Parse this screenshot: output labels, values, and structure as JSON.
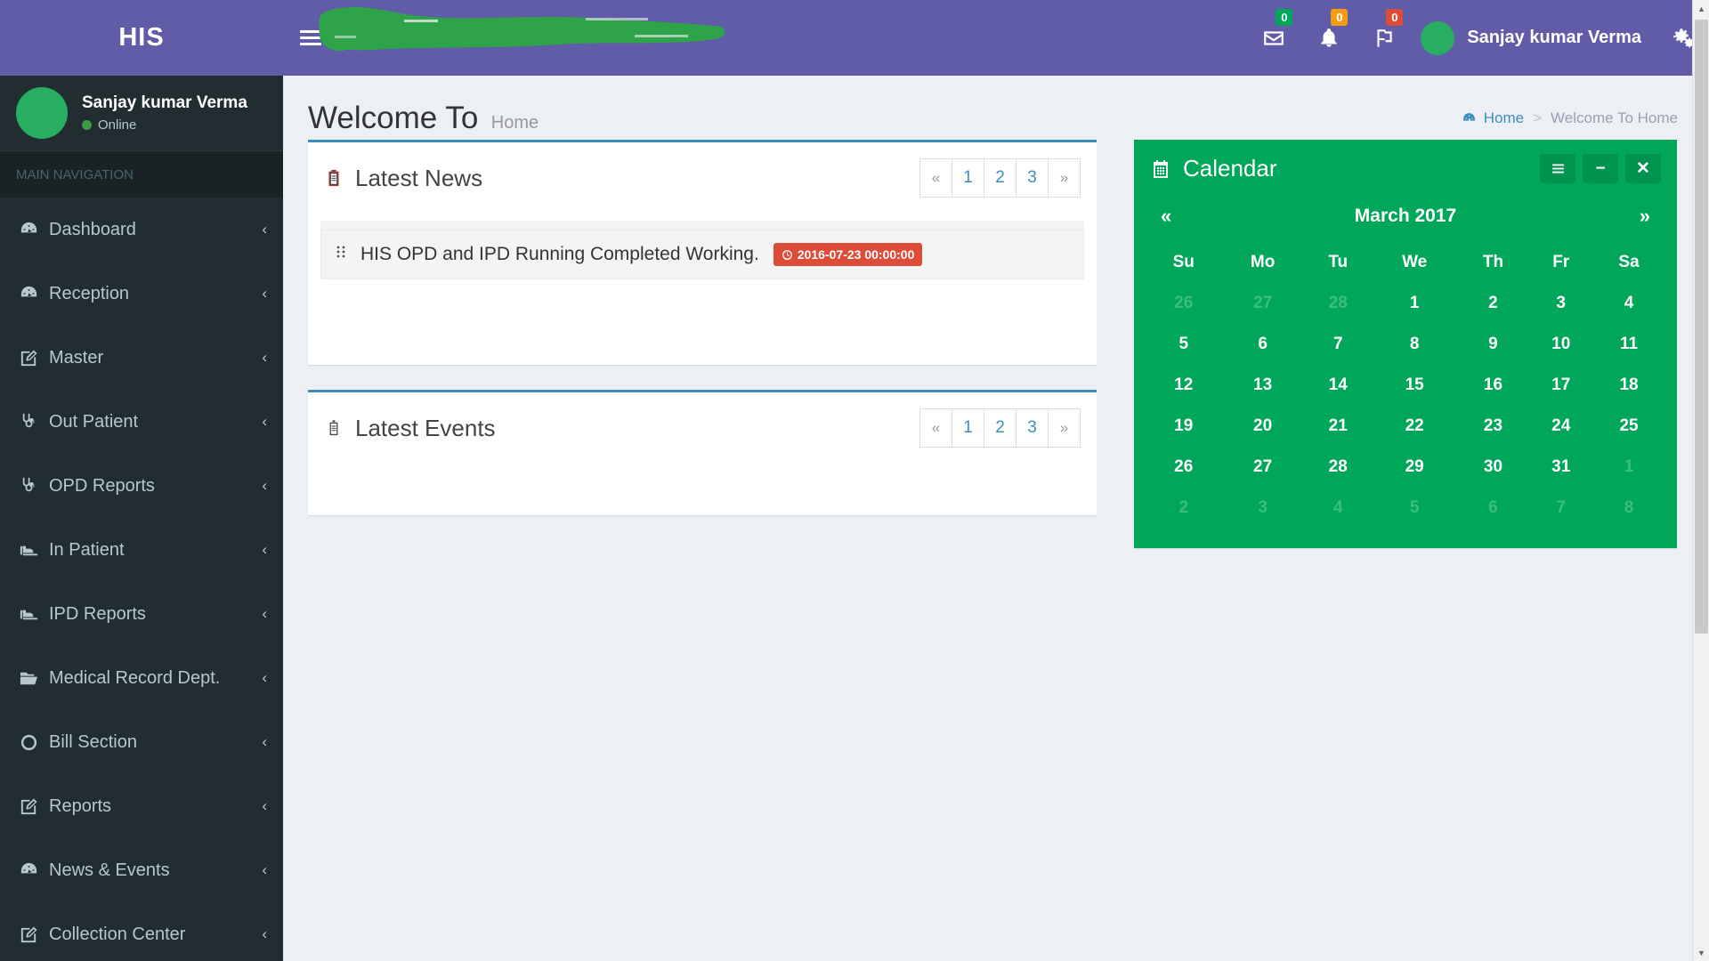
{
  "brand": {
    "logo_text": "HIS"
  },
  "colors": {
    "brand_purple": "#605ca8",
    "sidebar_dark": "#222d32",
    "calendar_green": "#00a65a",
    "box_accent_blue": "#3c8dbc",
    "badge_green": "#00a65a",
    "badge_yellow": "#f39c12",
    "badge_red": "#dd4b39",
    "content_bg": "#ecf0f5"
  },
  "navbar": {
    "toggle_icon": "hamburger-icon",
    "messages": {
      "icon": "envelope-icon",
      "count": "0"
    },
    "notifications": {
      "icon": "bell-icon",
      "count": "0"
    },
    "tasks": {
      "icon": "flag-icon",
      "count": "0"
    },
    "user_name": "Sanjay kumar Verma",
    "control_sidebar_icon": "gears-icon"
  },
  "sidebar": {
    "user": {
      "name": "Sanjay kumar Verma",
      "status": "Online"
    },
    "section_header": "MAIN NAVIGATION",
    "arrow": "‹",
    "items": [
      {
        "label": "Dashboard",
        "icon": "dashboard-icon"
      },
      {
        "label": "Reception",
        "icon": "dashboard-icon"
      },
      {
        "label": "Master",
        "icon": "edit-icon"
      },
      {
        "label": "Out Patient",
        "icon": "stethoscope-icon"
      },
      {
        "label": "OPD Reports",
        "icon": "stethoscope-icon"
      },
      {
        "label": "In Patient",
        "icon": "bed-icon"
      },
      {
        "label": "IPD Reports",
        "icon": "bed-icon"
      },
      {
        "label": "Medical Record Dept.",
        "icon": "folder-open-icon"
      },
      {
        "label": "Bill Section",
        "icon": "circle-icon"
      },
      {
        "label": "Reports",
        "icon": "edit-icon"
      },
      {
        "label": "News & Events",
        "icon": "dashboard-icon"
      },
      {
        "label": "Collection Center",
        "icon": "edit-icon"
      }
    ]
  },
  "content_header": {
    "title": "Welcome To",
    "subtitle": "Home",
    "breadcrumb": {
      "home_icon": "dashboard-icon",
      "home": "Home",
      "separator": ">",
      "current": "Welcome To Home"
    }
  },
  "latest_news": {
    "title": "Latest News",
    "icon": "clipboard-icon",
    "pagination": {
      "prev": "«",
      "pages": [
        "1",
        "2",
        "3"
      ],
      "next": "»"
    },
    "items": [
      {
        "grip_icon": "grip-icon",
        "text": "HIS OPD and IPD Running Completed Working.",
        "date_icon": "clock-icon",
        "date": "2016-07-23 00:00:00"
      }
    ]
  },
  "latest_events": {
    "title": "Latest Events",
    "icon": "clipboard-icon",
    "pagination": {
      "prev": "«",
      "pages": [
        "1",
        "2",
        "3"
      ],
      "next": "»"
    },
    "items": []
  },
  "calendar": {
    "title": "Calendar",
    "icon": "calendar-icon",
    "tools": {
      "menu": "bars-icon",
      "minimize": "−",
      "close": "✕"
    },
    "prev": "«",
    "next": "»",
    "month_label": "March 2017",
    "weekdays": [
      "Su",
      "Mo",
      "Tu",
      "We",
      "Th",
      "Fr",
      "Sa"
    ],
    "weeks": [
      [
        {
          "d": "26",
          "muted": true
        },
        {
          "d": "27",
          "muted": true
        },
        {
          "d": "28",
          "muted": true
        },
        {
          "d": "1"
        },
        {
          "d": "2"
        },
        {
          "d": "3"
        },
        {
          "d": "4"
        }
      ],
      [
        {
          "d": "5"
        },
        {
          "d": "6"
        },
        {
          "d": "7"
        },
        {
          "d": "8"
        },
        {
          "d": "9"
        },
        {
          "d": "10"
        },
        {
          "d": "11"
        }
      ],
      [
        {
          "d": "12"
        },
        {
          "d": "13"
        },
        {
          "d": "14"
        },
        {
          "d": "15"
        },
        {
          "d": "16"
        },
        {
          "d": "17"
        },
        {
          "d": "18"
        }
      ],
      [
        {
          "d": "19"
        },
        {
          "d": "20"
        },
        {
          "d": "21"
        },
        {
          "d": "22"
        },
        {
          "d": "23"
        },
        {
          "d": "24"
        },
        {
          "d": "25"
        }
      ],
      [
        {
          "d": "26"
        },
        {
          "d": "27"
        },
        {
          "d": "28"
        },
        {
          "d": "29"
        },
        {
          "d": "30"
        },
        {
          "d": "31"
        },
        {
          "d": "1",
          "muted": true
        }
      ],
      [
        {
          "d": "2",
          "muted": true
        },
        {
          "d": "3",
          "muted": true
        },
        {
          "d": "4",
          "muted": true
        },
        {
          "d": "5",
          "muted": true
        },
        {
          "d": "6",
          "muted": true
        },
        {
          "d": "7",
          "muted": true
        },
        {
          "d": "8",
          "muted": true
        }
      ]
    ]
  },
  "scrollbar": {
    "up": "▲",
    "down": "▼"
  }
}
